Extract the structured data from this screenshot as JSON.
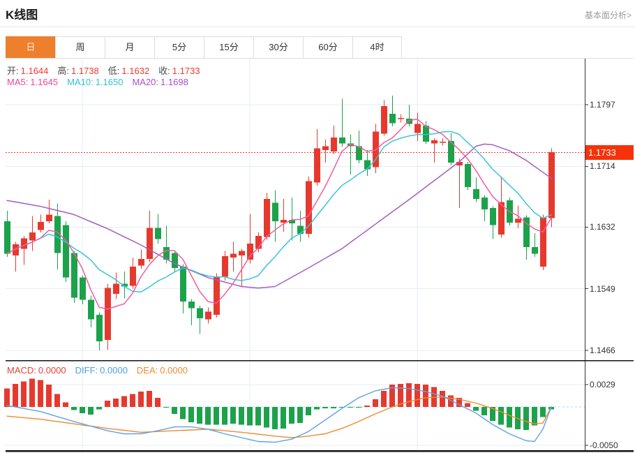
{
  "header": {
    "title": "K线图",
    "link_label": "基本面分析>"
  },
  "tabs": {
    "items": [
      "日",
      "周",
      "月",
      "5分",
      "15分",
      "30分",
      "60分",
      "4时"
    ],
    "selected_index": 0
  },
  "kline_legend": {
    "ohlc": [
      {
        "name": "open",
        "label": "开:",
        "value": "1.1644",
        "label_color": "#4a4a4a",
        "value_color": "#f03b30"
      },
      {
        "name": "high",
        "label": "高:",
        "value": "1.1738",
        "label_color": "#4a4a4a",
        "value_color": "#f03b30"
      },
      {
        "name": "low",
        "label": "低:",
        "value": "1.1632",
        "label_color": "#4a4a4a",
        "value_color": "#f03b30"
      },
      {
        "name": "close",
        "label": "收:",
        "value": "1.1733",
        "label_color": "#4a4a4a",
        "value_color": "#f03b30"
      }
    ],
    "ma": [
      {
        "name": "ma5",
        "label": "MA5:",
        "value": "1.1645",
        "label_color": "#f2459c",
        "value_color": "#f2459c"
      },
      {
        "name": "ma10",
        "label": "MA10:",
        "value": "1.1650",
        "label_color": "#2fc3db",
        "value_color": "#2fc3db"
      },
      {
        "name": "ma20",
        "label": "MA20:",
        "value": "1.1698",
        "label_color": "#a94fc9",
        "value_color": "#a94fc9"
      }
    ]
  },
  "macd_legend": [
    {
      "name": "macd",
      "label": "MACD:",
      "value": "0.0000",
      "label_color": "#e5413a",
      "value_color": "#e5413a"
    },
    {
      "name": "diff",
      "label": "DIFF:",
      "value": "0.0000",
      "label_color": "#4aa0e8",
      "value_color": "#4aa0e8"
    },
    {
      "name": "dea",
      "label": "DEA:",
      "value": "0.0000",
      "label_color": "#ef8a30",
      "value_color": "#ef8a30"
    }
  ],
  "main_axis": {
    "ticks": [
      {
        "label": "1.1797",
        "value": 1.1797
      },
      {
        "label": "1.1714",
        "value": 1.1714
      },
      {
        "label": "1.1632",
        "value": 1.1632
      },
      {
        "label": "1.1549",
        "value": 1.1549
      },
      {
        "label": "1.1466",
        "value": 1.1466
      }
    ],
    "price_tag": {
      "label": "1.1733",
      "value": 1.1733
    }
  },
  "macd_axis": {
    "ticks": [
      {
        "label": "0.0029",
        "value": 0.0029
      },
      {
        "label": "-0.0050",
        "value": -0.005
      }
    ]
  },
  "colors": {
    "up": "#e6392e",
    "down": "#1ca24b",
    "ma5": "#f35c9d",
    "ma10": "#3bc4da",
    "ma20": "#a45ec1",
    "diff": "#5ba3e6",
    "dea": "#f08a2f",
    "grid": "#e4edf5",
    "axis": "#333333",
    "border": "#111111",
    "dotted_price": "#f5392c",
    "zero_dash": "#b0d7ef"
  },
  "chart_data": {
    "type": "candlestick+macd",
    "title": "K线图 daily candles with MA5/MA10/MA20 overlays and MACD histogram",
    "x_axis": "66 trading periods (no tick labels shown)",
    "y_axis_range": {
      "top": 1.1797,
      "bottom": 1.1466
    },
    "current_price": 1.1733,
    "last_candle": {
      "open": 1.1644,
      "high": 1.1738,
      "low": 1.1632,
      "close": 1.1733
    },
    "candles": {
      "open": [
        1.164,
        1.1594,
        1.1603,
        1.1614,
        1.1628,
        1.164,
        1.1647,
        1.1635,
        1.1597,
        1.1564,
        1.1534,
        1.1514,
        1.148,
        1.1542,
        1.1556,
        1.1553,
        1.158,
        1.1589,
        1.1631,
        1.1605,
        1.1597,
        1.1579,
        1.1532,
        1.1523,
        1.1508,
        1.1514,
        1.1565,
        1.1591,
        1.1594,
        1.1588,
        1.1603,
        1.1619,
        1.1665,
        1.1638,
        1.1642,
        1.1634,
        1.1623,
        1.1692,
        1.1736,
        1.1734,
        1.1753,
        1.1745,
        1.1741,
        1.1722,
        1.1713,
        1.1758,
        1.1785,
        1.1778,
        1.1778,
        1.1759,
        1.1769,
        1.1745,
        1.1747,
        1.1748,
        1.1715,
        1.1717,
        1.1683,
        1.1672,
        1.1658,
        1.1622,
        1.1668,
        1.1638,
        1.1645,
        1.1605,
        1.1579,
        1.1644
      ],
      "close": [
        1.1596,
        1.1609,
        1.1617,
        1.1625,
        1.1639,
        1.1649,
        1.1597,
        1.1564,
        1.1537,
        1.1534,
        1.1508,
        1.1478,
        1.155,
        1.1556,
        1.1552,
        1.1579,
        1.1589,
        1.1631,
        1.1616,
        1.1588,
        1.1577,
        1.1532,
        1.1523,
        1.1509,
        1.1518,
        1.1565,
        1.1593,
        1.1596,
        1.16,
        1.161,
        1.162,
        1.167,
        1.164,
        1.1642,
        1.1637,
        1.1623,
        1.1694,
        1.1738,
        1.1741,
        1.1753,
        1.1745,
        1.1741,
        1.1722,
        1.171,
        1.1761,
        1.1795,
        1.1772,
        1.1779,
        1.1771,
        1.1771,
        1.1747,
        1.1749,
        1.1747,
        1.1719,
        1.172,
        1.1686,
        1.167,
        1.1656,
        1.1635,
        1.1666,
        1.1638,
        1.1643,
        1.1605,
        1.1596,
        1.1645,
        1.1733
      ],
      "high": [
        1.1654,
        1.1612,
        1.162,
        1.1647,
        1.1649,
        1.1669,
        1.1664,
        1.164,
        1.16,
        1.1567,
        1.154,
        1.1517,
        1.1556,
        1.1571,
        1.1572,
        1.1591,
        1.1602,
        1.1654,
        1.165,
        1.1634,
        1.16,
        1.1582,
        1.1535,
        1.1526,
        1.1524,
        1.157,
        1.16,
        1.1612,
        1.1603,
        1.165,
        1.1625,
        1.1678,
        1.1682,
        1.167,
        1.1672,
        1.1654,
        1.17,
        1.1764,
        1.175,
        1.1769,
        1.1805,
        1.1757,
        1.1762,
        1.1736,
        1.1771,
        1.1803,
        1.1809,
        1.1784,
        1.1797,
        1.1786,
        1.1775,
        1.1752,
        1.1752,
        1.1759,
        1.1724,
        1.172,
        1.1699,
        1.1675,
        1.166,
        1.17,
        1.1672,
        1.1661,
        1.1648,
        1.1624,
        1.1649,
        1.1738
      ],
      "low": [
        1.1592,
        1.1572,
        1.1581,
        1.16,
        1.1625,
        1.1637,
        1.1575,
        1.1558,
        1.153,
        1.1528,
        1.1497,
        1.1466,
        1.1467,
        1.1535,
        1.1536,
        1.1549,
        1.1576,
        1.1585,
        1.161,
        1.1583,
        1.1572,
        1.1516,
        1.15,
        1.1488,
        1.1502,
        1.151,
        1.156,
        1.1572,
        1.1551,
        1.1583,
        1.1598,
        1.1615,
        1.1612,
        1.1626,
        1.1614,
        1.1612,
        1.1618,
        1.1688,
        1.1719,
        1.173,
        1.174,
        1.1703,
        1.1718,
        1.1701,
        1.1705,
        1.1755,
        1.1768,
        1.1773,
        1.1768,
        1.1748,
        1.1744,
        1.1719,
        1.1742,
        1.1715,
        1.1658,
        1.1682,
        1.1666,
        1.164,
        1.1616,
        1.1618,
        1.1634,
        1.1631,
        1.1588,
        1.1592,
        1.1574,
        1.1632
      ]
    },
    "ma20_anchors": [
      [
        0,
        1.1668
      ],
      [
        4,
        1.166
      ],
      [
        8,
        1.1649
      ],
      [
        12,
        1.163
      ],
      [
        16,
        1.1608
      ],
      [
        20,
        1.1583
      ],
      [
        24,
        1.1564
      ],
      [
        28,
        1.1552
      ],
      [
        30,
        1.155
      ],
      [
        32,
        1.1552
      ],
      [
        36,
        1.1577
      ],
      [
        40,
        1.1603
      ],
      [
        44,
        1.1636
      ],
      [
        48,
        1.1669
      ],
      [
        52,
        1.1703
      ],
      [
        54,
        1.172
      ],
      [
        56,
        1.1741
      ],
      [
        57,
        1.1744
      ],
      [
        58,
        1.1743
      ],
      [
        60,
        1.1735
      ],
      [
        62,
        1.1722
      ],
      [
        64,
        1.1706
      ],
      [
        65,
        1.1698
      ]
    ],
    "macd": {
      "hist": [
        0.0024,
        0.003,
        0.0033,
        0.0037,
        0.0035,
        0.0029,
        0.0017,
        0.0006,
        -0.0004,
        -0.0008,
        -0.001,
        -0.0003,
        0.0008,
        0.0011,
        0.0014,
        0.0017,
        0.002,
        0.0021,
        0.0012,
        -0.0001,
        -0.0009,
        -0.0016,
        -0.002,
        -0.0022,
        -0.0023,
        -0.0023,
        -0.0023,
        -0.0022,
        -0.0023,
        -0.0024,
        -0.0024,
        -0.0027,
        -0.0029,
        -0.0028,
        -0.0022,
        -0.0021,
        -0.0011,
        -0.0003,
        -0.0002,
        -0.0002,
        -0.0001,
        -0.0001,
        -0.0001,
        0.0002,
        0.001,
        0.0021,
        0.0029,
        0.003,
        0.0031,
        0.003,
        0.0029,
        0.0026,
        0.0021,
        0.0015,
        0.0012,
        0.0005,
        -0.0005,
        -0.0011,
        -0.0018,
        -0.0023,
        -0.0027,
        -0.0029,
        -0.003,
        -0.0024,
        -0.0013,
        -0.0003
      ],
      "diff_anchors": [
        [
          0,
          0.0002
        ],
        [
          4,
          -0.0006
        ],
        [
          8,
          -0.0019
        ],
        [
          10,
          -0.0025
        ],
        [
          12,
          -0.0031
        ],
        [
          14,
          -0.0035
        ],
        [
          16,
          -0.0035
        ],
        [
          18,
          -0.0031
        ],
        [
          20,
          -0.0026
        ],
        [
          22,
          -0.0026
        ],
        [
          24,
          -0.0029
        ],
        [
          26,
          -0.0035
        ],
        [
          28,
          -0.004
        ],
        [
          30,
          -0.0045
        ],
        [
          32,
          -0.0046
        ],
        [
          34,
          -0.0042
        ],
        [
          36,
          -0.0032
        ],
        [
          38,
          -0.0017
        ],
        [
          40,
          -0.0002
        ],
        [
          42,
          0.0012
        ],
        [
          44,
          0.0021
        ],
        [
          46,
          0.0025
        ],
        [
          48,
          0.0024
        ],
        [
          50,
          0.002
        ],
        [
          52,
          0.0014
        ],
        [
          54,
          0.0003
        ],
        [
          56,
          -0.0008
        ],
        [
          58,
          -0.0023
        ],
        [
          60,
          -0.0035
        ],
        [
          62,
          -0.0044
        ],
        [
          63,
          -0.0045
        ],
        [
          64,
          -0.0029
        ],
        [
          65,
          0.0
        ]
      ],
      "dea_anchors": [
        [
          0,
          -0.0012
        ],
        [
          4,
          -0.0016
        ],
        [
          8,
          -0.0022
        ],
        [
          12,
          -0.0028
        ],
        [
          16,
          -0.0033
        ],
        [
          20,
          -0.0031
        ],
        [
          24,
          -0.0029
        ],
        [
          28,
          -0.0033
        ],
        [
          32,
          -0.0038
        ],
        [
          34,
          -0.004
        ],
        [
          36,
          -0.0038
        ],
        [
          38,
          -0.0035
        ],
        [
          40,
          -0.0028
        ],
        [
          42,
          -0.0019
        ],
        [
          44,
          -0.0009
        ],
        [
          46,
          0.0
        ],
        [
          48,
          0.0007
        ],
        [
          50,
          0.0012
        ],
        [
          52,
          0.0013
        ],
        [
          54,
          0.001
        ],
        [
          56,
          0.0005
        ],
        [
          58,
          -0.0002
        ],
        [
          60,
          -0.0011
        ],
        [
          62,
          -0.0019
        ],
        [
          63,
          -0.0022
        ],
        [
          64,
          -0.0021
        ],
        [
          65,
          0.0
        ]
      ]
    }
  }
}
